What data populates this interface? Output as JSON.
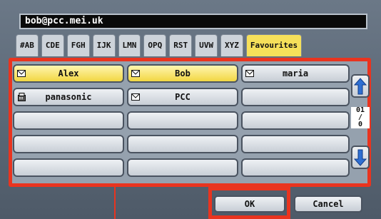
{
  "address_bar": {
    "value": "bob@pcc.mei.uk"
  },
  "tabs": [
    {
      "label": "#AB",
      "active": false
    },
    {
      "label": "CDE",
      "active": false
    },
    {
      "label": "FGH",
      "active": false
    },
    {
      "label": "IJK",
      "active": false
    },
    {
      "label": "LMN",
      "active": false
    },
    {
      "label": "OPQ",
      "active": false
    },
    {
      "label": "RST",
      "active": false
    },
    {
      "label": "UVW",
      "active": false
    },
    {
      "label": "XYZ",
      "active": false
    },
    {
      "label": "Favourites",
      "active": true
    }
  ],
  "contacts": [
    {
      "label": "Alex",
      "icon": "email-icon",
      "selected": true
    },
    {
      "label": "Bob",
      "icon": "email-icon",
      "selected": true
    },
    {
      "label": "maria",
      "icon": "email-icon",
      "selected": false
    },
    {
      "label": "panasonic",
      "icon": "fax-icon",
      "selected": false
    },
    {
      "label": "PCC",
      "icon": "email-icon",
      "selected": false
    },
    {
      "label": "",
      "icon": "",
      "selected": false
    },
    {
      "label": "",
      "icon": "",
      "selected": false
    },
    {
      "label": "",
      "icon": "",
      "selected": false
    },
    {
      "label": "",
      "icon": "",
      "selected": false
    },
    {
      "label": "",
      "icon": "",
      "selected": false
    },
    {
      "label": "",
      "icon": "",
      "selected": false
    },
    {
      "label": "",
      "icon": "",
      "selected": false
    },
    {
      "label": "",
      "icon": "",
      "selected": false
    },
    {
      "label": "",
      "icon": "",
      "selected": false
    },
    {
      "label": "",
      "icon": "",
      "selected": false
    }
  ],
  "pager": {
    "current": "01",
    "separator": "/",
    "total": "0"
  },
  "buttons": {
    "ok": "OK",
    "cancel": "Cancel"
  },
  "colors": {
    "highlight": "#e9341f",
    "selected": "#f2d743",
    "arrow": "#2f6fd2"
  }
}
